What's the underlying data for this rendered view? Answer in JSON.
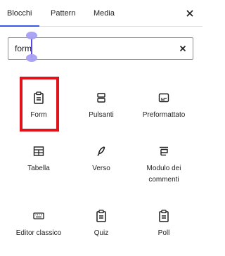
{
  "tabs": [
    {
      "label": "Blocchi"
    },
    {
      "label": "Pattern"
    },
    {
      "label": "Media"
    }
  ],
  "search": {
    "value": "form",
    "placeholder": ""
  },
  "blocks": [
    {
      "label": "Form",
      "icon": "form-icon"
    },
    {
      "label": "Pulsanti",
      "icon": "buttons-icon"
    },
    {
      "label": "Preformattato",
      "icon": "preformatted-icon"
    },
    {
      "label": "Tabella",
      "icon": "table-icon"
    },
    {
      "label": "Verso",
      "icon": "verse-icon"
    },
    {
      "label": "Modulo dei commenti",
      "icon": "comments-form-icon"
    },
    {
      "label": "Editor classico",
      "icon": "keyboard-icon"
    },
    {
      "label": "Quiz",
      "icon": "quiz-icon"
    },
    {
      "label": "Poll",
      "icon": "poll-icon"
    }
  ],
  "colors": {
    "accent": "#3858e9",
    "highlight": "#e0131a",
    "selection": "#a79ef2"
  }
}
